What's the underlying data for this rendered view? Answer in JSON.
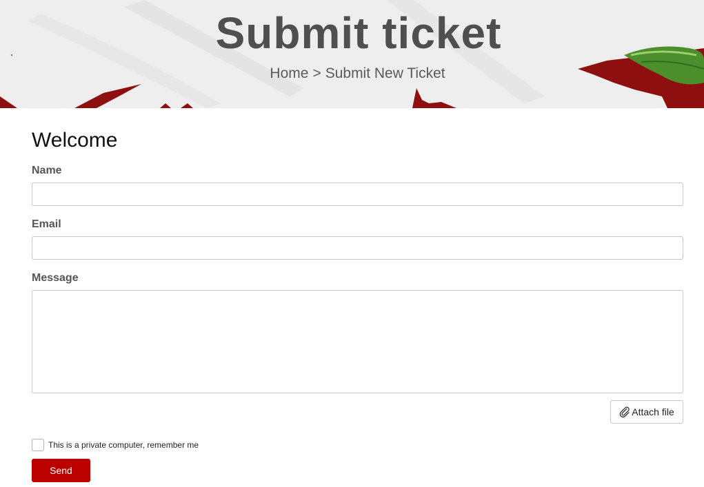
{
  "hero": {
    "title": "Submit ticket",
    "breadcrumb": {
      "home_label": "Home",
      "separator": ">",
      "current_label": "Submit New Ticket"
    }
  },
  "form": {
    "heading": "Welcome",
    "name": {
      "label": "Name",
      "value": ""
    },
    "email": {
      "label": "Email",
      "value": ""
    },
    "message": {
      "label": "Message",
      "value": ""
    },
    "attach_label": "Attach file",
    "attach_icon": "paperclip-icon",
    "remember": {
      "label": "This is a private computer, remember me",
      "checked": false
    },
    "send_label": "Send"
  },
  "colors": {
    "accent": "#bb0000",
    "hero_bg": "#eeeeee",
    "leaf_red": "#8e0f0f",
    "leaf_green": "#4c8f2c",
    "title_text": "#4f4f4f"
  }
}
